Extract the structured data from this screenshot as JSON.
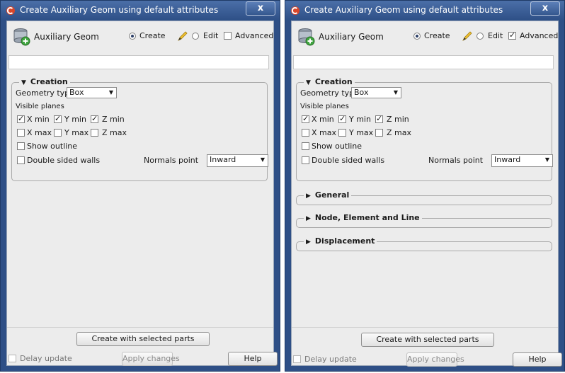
{
  "windows": [
    {
      "title": "Create Auxiliary Geom using default attributes",
      "close_label": "x",
      "app_name": "Auxiliary Geom",
      "mode": {
        "create": "Create",
        "edit": "Edit",
        "advanced": "Advanced",
        "advanced_checked": false
      },
      "creation": {
        "title": "Creation",
        "geometry_type_label": "Geometry type",
        "geometry_type_value": "Box",
        "visible_planes_label": "Visible planes",
        "planes": {
          "xmin": "X min",
          "ymin": "Y min",
          "zmin": "Z min",
          "xmax": "X max",
          "ymax": "Y max",
          "zmax": "Z max"
        },
        "show_outline": "Show outline",
        "double_sided": "Double sided walls",
        "normals_label": "Normals point",
        "normals_value": "Inward"
      },
      "buttons": {
        "create_parts": "Create with selected parts",
        "delay_update": "Delay update",
        "apply": "Apply changes",
        "help": "Help"
      }
    },
    {
      "title": "Create Auxiliary Geom using default attributes",
      "close_label": "x",
      "app_name": "Auxiliary Geom",
      "mode": {
        "create": "Create",
        "edit": "Edit",
        "advanced": "Advanced",
        "advanced_checked": true
      },
      "creation": {
        "title": "Creation",
        "geometry_type_label": "Geometry type",
        "geometry_type_value": "Box",
        "visible_planes_label": "Visible planes",
        "planes": {
          "xmin": "X min",
          "ymin": "Y min",
          "zmin": "Z min",
          "xmax": "X max",
          "ymax": "Y max",
          "zmax": "Z max"
        },
        "show_outline": "Show outline",
        "double_sided": "Double sided walls",
        "normals_label": "Normals point",
        "normals_value": "Inward"
      },
      "sections": [
        "General",
        "Node, Element and Line",
        "Displacement"
      ],
      "buttons": {
        "create_parts": "Create with selected parts",
        "delay_update": "Delay update",
        "apply": "Apply changes",
        "help": "Help"
      }
    }
  ]
}
